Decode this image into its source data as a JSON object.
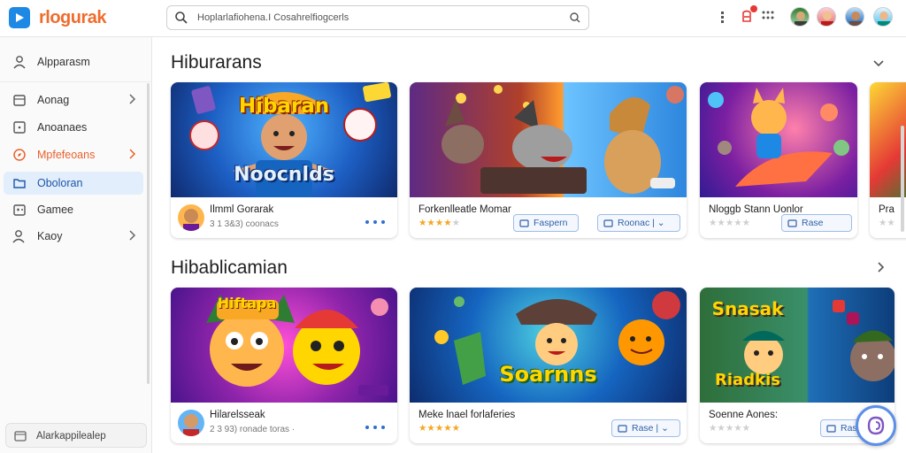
{
  "app": {
    "name": "rlogurak",
    "accent": "#ef6c2d",
    "logo_color": "#1e88e5"
  },
  "search": {
    "text": "Hoplarlafiohena.I   Cosahrelfiogcerls",
    "icon": "search-icon",
    "clear_icon": "camera-icon"
  },
  "header_icons": [
    "more-vert-icon",
    "notification-icon",
    "apps-grid-icon",
    "avatar",
    "avatar",
    "avatar",
    "avatar"
  ],
  "sidebar": {
    "top_item": {
      "label": "Alpparasm",
      "icon": "user-icon"
    },
    "items": [
      {
        "label": "Aonag",
        "icon": "calendar-icon",
        "chevron": true
      },
      {
        "label": "Anoanaes",
        "icon": "square-icon",
        "chevron": false
      },
      {
        "label": "Mpfefeoans",
        "icon": "compass-icon",
        "chevron": true,
        "highlight": "orange"
      },
      {
        "label": "Oboloran",
        "icon": "folder-icon",
        "chevron": false,
        "active": true
      },
      {
        "label": "Gamee",
        "icon": "gamepad-icon",
        "chevron": false
      },
      {
        "label": "Kaoy",
        "icon": "user-icon",
        "chevron": true
      }
    ],
    "bottom": {
      "label": "Alarkappilealep",
      "icon": "settings-icon"
    }
  },
  "sections": [
    {
      "title": "Hiburarans",
      "more_icon": "chevron-down-icon",
      "cards": [
        {
          "art_text": [
            "Hibaran",
            "Noocnlds"
          ],
          "title": "Ilmml Gorarak",
          "sub": "3 1 3&3)  coonacs",
          "has_thumb": true,
          "stars": 0,
          "button": null
        },
        {
          "art_text": [],
          "title": "Forkenlleatle Momar",
          "sub": "",
          "has_thumb": false,
          "stars": 4,
          "stars_total": 5,
          "button": "Faspern"
        },
        {
          "art_text": [],
          "title": "Nloggb Stann Uonlor",
          "sub": "",
          "has_thumb": false,
          "stars": 0,
          "stars_total": 5,
          "button": "Rase"
        },
        {
          "art_text": [],
          "title": "Pra",
          "sub": "",
          "has_thumb": false,
          "stars": 0,
          "stars_total": 2,
          "button": null
        }
      ],
      "second_button": "Roonac | ⌄"
    },
    {
      "title": "Hibablicamian",
      "more_icon": "chevron-right-icon",
      "cards": [
        {
          "art_text": [
            "Hiftapa"
          ],
          "title": "Hilarelsseak",
          "sub": "2 3  93)  ronade toras  ·",
          "has_thumb": true,
          "stars": 0,
          "button": null
        },
        {
          "art_text": [
            "Soarnns"
          ],
          "title": "Meke lnael forlaferies",
          "sub": "",
          "has_thumb": false,
          "stars": 5,
          "stars_total": 5,
          "button": "Rase | ⌄"
        },
        {
          "art_text": [
            "Snasak",
            "Riadkis"
          ],
          "title": "Soenne Aones:",
          "sub": "",
          "has_thumb": false,
          "stars": 0,
          "stars_total": 5,
          "button": "Ras"
        }
      ]
    }
  ],
  "fab_icon": "assistant-icon"
}
